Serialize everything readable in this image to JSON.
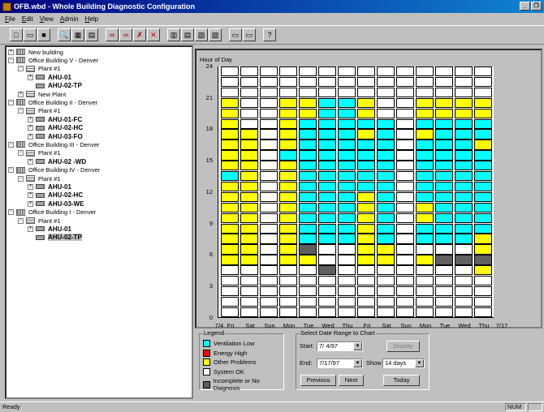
{
  "window": {
    "title": "OFB.wbd - Whole Building Diagnostic Configuration"
  },
  "menu": [
    "File",
    "Edit",
    "View",
    "Admin",
    "Help"
  ],
  "menu_underline": [
    "F",
    "E",
    "V",
    "A",
    "H"
  ],
  "toolbar": {
    "buttons": [
      {
        "name": "new-icon",
        "glyph": "□"
      },
      {
        "name": "open-icon",
        "glyph": "▭"
      },
      {
        "name": "save-icon",
        "glyph": "■"
      },
      {
        "name": "sep"
      },
      {
        "name": "search-icon",
        "glyph": "🔍"
      },
      {
        "name": "grid-view-icon",
        "glyph": "▦"
      },
      {
        "name": "chart-view-icon",
        "glyph": "▤"
      },
      {
        "name": "sep"
      },
      {
        "name": "link-icon",
        "glyph": "∞"
      },
      {
        "name": "link-add-icon",
        "glyph": "∞"
      },
      {
        "name": "link-remove-icon",
        "glyph": "✗"
      },
      {
        "name": "delete-icon",
        "glyph": "✕"
      },
      {
        "name": "sep"
      },
      {
        "name": "building-icon",
        "glyph": "▥"
      },
      {
        "name": "plant-icon",
        "glyph": "▤"
      },
      {
        "name": "ahu-icon",
        "glyph": "▧"
      },
      {
        "name": "ahu-config-icon",
        "glyph": "▨"
      },
      {
        "name": "sep"
      },
      {
        "name": "properties-icon",
        "glyph": "▭"
      },
      {
        "name": "report-icon",
        "glyph": "▭"
      },
      {
        "name": "sep"
      },
      {
        "name": "help-icon",
        "glyph": "?"
      }
    ]
  },
  "tree": [
    {
      "level": 0,
      "exp": "+",
      "type": "bldg",
      "label": "New building",
      "bold": false
    },
    {
      "level": 0,
      "exp": "−",
      "type": "bldg",
      "label": "Office Building V - Denver",
      "bold": false
    },
    {
      "level": 1,
      "exp": "−",
      "type": "plant",
      "label": "Plant #1",
      "bold": false
    },
    {
      "level": 2,
      "exp": "+",
      "type": "ahu",
      "label": "AHU-01",
      "bold": true
    },
    {
      "level": 2,
      "exp": "",
      "type": "ahu",
      "label": "AHU-02-TP",
      "bold": true
    },
    {
      "level": 1,
      "exp": "+",
      "type": "plant",
      "label": "New Plant",
      "bold": false
    },
    {
      "level": 0,
      "exp": "−",
      "type": "bldg",
      "label": "Office Building II - Denver",
      "bold": false
    },
    {
      "level": 1,
      "exp": "−",
      "type": "plant",
      "label": "Plant #1",
      "bold": false
    },
    {
      "level": 2,
      "exp": "+",
      "type": "ahu",
      "label": "AHU-01-FC",
      "bold": true
    },
    {
      "level": 2,
      "exp": "+",
      "type": "ahu",
      "label": "AHU-02-HC",
      "bold": true
    },
    {
      "level": 2,
      "exp": "+",
      "type": "ahu",
      "label": "AHU-03-FO",
      "bold": true
    },
    {
      "level": 0,
      "exp": "−",
      "type": "bldg",
      "label": "Office Building III - Denver",
      "bold": false
    },
    {
      "level": 1,
      "exp": "−",
      "type": "plant",
      "label": "Plant #1",
      "bold": false
    },
    {
      "level": 2,
      "exp": "+",
      "type": "ahu",
      "label": "AHU-02 -WD",
      "bold": true
    },
    {
      "level": 0,
      "exp": "−",
      "type": "bldg",
      "label": "Office Building IV - Denver",
      "bold": false
    },
    {
      "level": 1,
      "exp": "−",
      "type": "plant",
      "label": "Plant #1",
      "bold": false
    },
    {
      "level": 2,
      "exp": "+",
      "type": "ahu",
      "label": "AHU-01",
      "bold": true
    },
    {
      "level": 2,
      "exp": "+",
      "type": "ahu",
      "label": "AHU-02-HC",
      "bold": true
    },
    {
      "level": 2,
      "exp": "+",
      "type": "ahu",
      "label": "AHU-03-WE",
      "bold": true
    },
    {
      "level": 0,
      "exp": "−",
      "type": "bldg",
      "label": "Office Building I - Denver",
      "bold": false
    },
    {
      "level": 1,
      "exp": "−",
      "type": "plant",
      "label": "Plant #1",
      "bold": false
    },
    {
      "level": 2,
      "exp": "+",
      "type": "ahu",
      "label": "AHU-01",
      "bold": true
    },
    {
      "level": 2,
      "exp": "",
      "type": "ahu",
      "label": "AHU-02-TP",
      "bold": true,
      "selected": true
    }
  ],
  "chart_data": {
    "type": "heatmap",
    "title": "Hour of Day",
    "y_ticks": [
      0,
      3,
      6,
      9,
      12,
      15,
      18,
      21,
      24
    ],
    "x_labels": [
      "7/4",
      "Fri",
      "Sat",
      "Sun",
      "Mon",
      "Tue",
      "Wed",
      "Thu",
      "Fri",
      "Sat",
      "Sun",
      "Mon",
      "Tue",
      "Wed",
      "Thu",
      "7/17"
    ],
    "color_key": {
      "W": "#ffffff",
      "C": "#00ffff",
      "Y": "#ffff00",
      "G": "#606060",
      "R": "#ff0000"
    },
    "columns": [
      "WWWWWYYYYYYYYCYYYYYYYWWW",
      "WWWWWYYYYYYYYYYYYYWWWWWW",
      "WWWWWWWWWWWWWWWWWWWWWWWW",
      "WWWWWYYYYYYYYYYCYYYYYWWW",
      "WWWWWYGCCCCCCCCCCCCYYWWW",
      "WWWWGWWCCCCCCCCCCCCCCWWW",
      "WWWWWWWCCCCCCCCCCCCCCWWW",
      "WWWWWYYYYYYYCCCCCYCYYWWW",
      "WWWWWYYCCCCCCCCCCCCWWWWW",
      "WWWWWWWWWWWWWWWWWWWWWWWW",
      "WWWWWYWCCYYCCCCCCYCYYWWW",
      "WWWWWGWCCCCCCCCCCCCYYWWW",
      "WWWWWGWCCCCCCCCCCCCYYWWW",
      "WWWWYGYYCCCCCCCCYCCYYWWW"
    ]
  },
  "legend": {
    "title": "Legend",
    "items": [
      {
        "label": "Ventilation Low",
        "color": "#00ffff"
      },
      {
        "label": "Energy High",
        "color": "#ff0000"
      },
      {
        "label": "Other Problems",
        "color": "#ffff00"
      },
      {
        "label": "System OK",
        "color": "#ffffff"
      },
      {
        "label": "Incomplete or No Diagnosis",
        "color": "#606060"
      }
    ]
  },
  "date_range": {
    "title": "Select Date Range to Chart",
    "start_label": "Start:",
    "start_value": "7/ 4/97",
    "end_label": "End:",
    "end_value": "7/17/97",
    "show_label": "Show",
    "show_value": "14 days",
    "display_label": "Display",
    "previous_label": "Previous",
    "next_label": "Next",
    "today_label": "Today"
  },
  "status": {
    "text": "Ready",
    "num": "NUM"
  }
}
